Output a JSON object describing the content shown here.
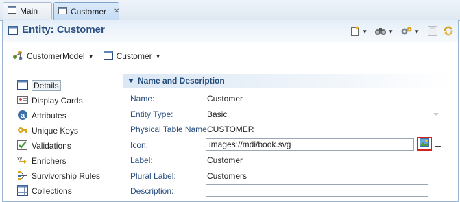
{
  "tabs": [
    {
      "label": "Main",
      "active": false
    },
    {
      "label": "Customer",
      "active": true
    }
  ],
  "editor": {
    "title": "Entity: Customer"
  },
  "selectors": {
    "model": "CustomerModel",
    "entity": "Customer"
  },
  "sidebar": {
    "items": [
      {
        "label": "Details",
        "icon": "details-icon"
      },
      {
        "label": "Display Cards",
        "icon": "display-cards-icon"
      },
      {
        "label": "Attributes",
        "icon": "attributes-icon"
      },
      {
        "label": "Unique Keys",
        "icon": "unique-keys-icon"
      },
      {
        "label": "Validations",
        "icon": "validations-icon"
      },
      {
        "label": "Enrichers",
        "icon": "enrichers-icon"
      },
      {
        "label": "Survivorship Rules",
        "icon": "survivorship-icon"
      },
      {
        "label": "Collections",
        "icon": "collections-icon"
      }
    ]
  },
  "section": {
    "title": "Name and Description"
  },
  "form": {
    "name": {
      "label": "Name:",
      "value": "Customer"
    },
    "entity_type": {
      "label": "Entity Type:",
      "value": "Basic"
    },
    "physical_table": {
      "label": "Physical Table Name:",
      "value": "CUSTOMER"
    },
    "icon": {
      "label": "Icon:",
      "value": "images://mdi/book.svg"
    },
    "display_label": {
      "label": "Label:",
      "value": "Customer"
    },
    "plural_label": {
      "label": "Plural Label:",
      "value": "Customers"
    },
    "description": {
      "label": "Description:",
      "value": ""
    }
  },
  "colors": {
    "accent": "#2a4f80",
    "highlight_border": "#d32020"
  }
}
